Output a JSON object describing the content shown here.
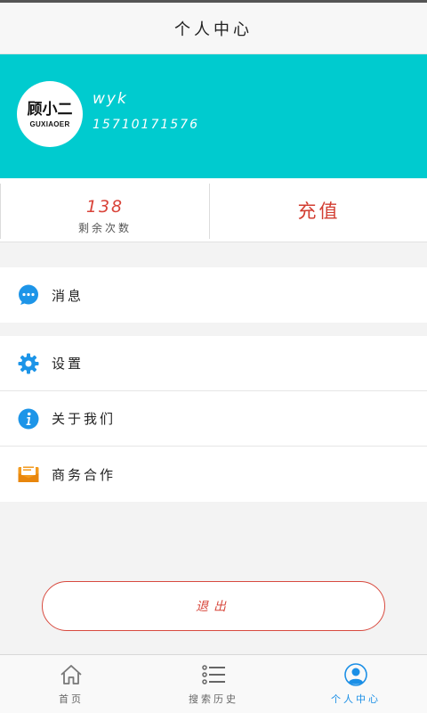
{
  "header": {
    "title": "个人中心"
  },
  "profile": {
    "avatar_text": "顾小二",
    "avatar_subtext": "GUXIAOER",
    "username": "wyk",
    "phone": "15710171576"
  },
  "stats": {
    "remaining_count": "138",
    "remaining_label": "剩余次数",
    "recharge_label": "充值"
  },
  "menu": {
    "messages": {
      "label": "消息",
      "icon": "chat-bubble-icon"
    },
    "settings": {
      "label": "设置",
      "icon": "gear-icon"
    },
    "about": {
      "label": "关于我们",
      "icon": "info-icon"
    },
    "business": {
      "label": "商务合作",
      "icon": "mail-icon"
    }
  },
  "logout": {
    "label": "退出"
  },
  "tabbar": {
    "items": [
      {
        "label": "首页",
        "icon": "home-icon",
        "active": false
      },
      {
        "label": "搜索历史",
        "icon": "list-icon",
        "active": false
      },
      {
        "label": "个人中心",
        "icon": "user-icon",
        "active": true
      }
    ]
  },
  "colors": {
    "accent": "#00cbcf",
    "danger": "#d84a3f",
    "active_tab": "#1b8fe6",
    "icon_blue": "#1d95e8",
    "icon_orange": "#f39a1e"
  }
}
